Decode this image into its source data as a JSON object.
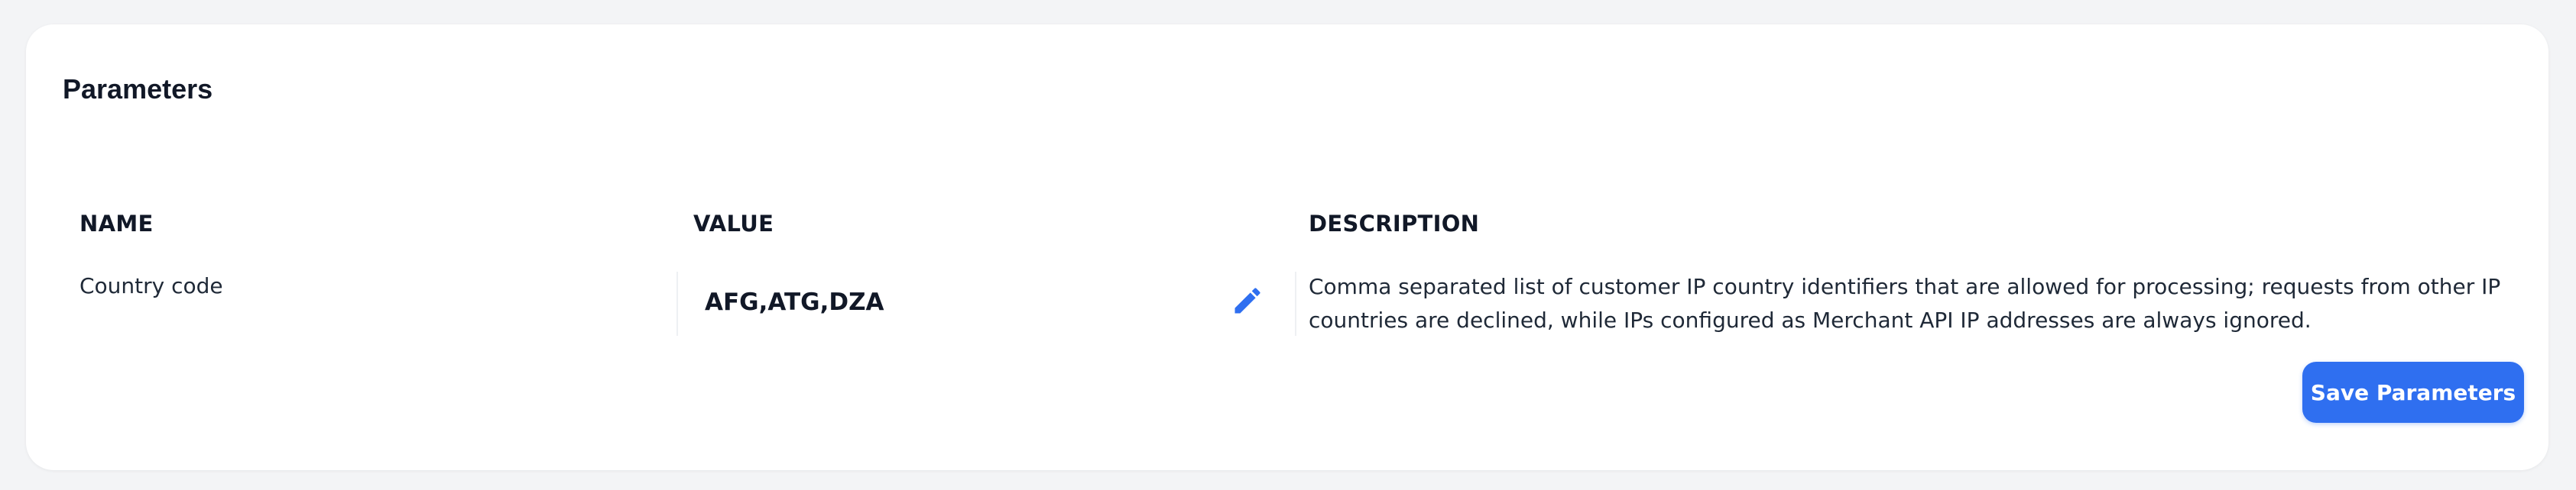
{
  "panel": {
    "title": "Parameters"
  },
  "table": {
    "columns": {
      "name": "NAME",
      "value": "VALUE",
      "description": "DESCRIPTION"
    },
    "rows": [
      {
        "name": "Country code",
        "value": "AFG,ATG,DZA",
        "description": "Comma separated list of customer IP country identifiers that are allowed for processing; requests from other IP countries are declined, while IPs configured as Merchant API IP addresses are always ignored."
      }
    ]
  },
  "actions": {
    "save_label": "Save Parameters"
  },
  "icons": {
    "edit": "pencil-icon"
  },
  "colors": {
    "accent": "#2f6ff0",
    "background": "#f3f4f6",
    "card": "#ffffff"
  }
}
